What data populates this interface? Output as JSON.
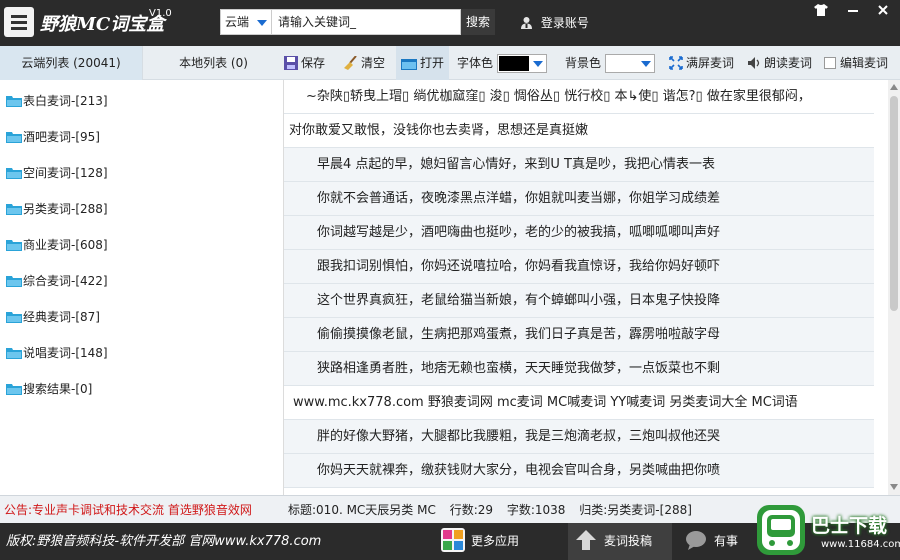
{
  "app": {
    "title": "野狼MC词宝盒",
    "version": "V1.0",
    "window_controls": [
      "shirt-icon",
      "minimize-icon",
      "close-icon"
    ]
  },
  "search": {
    "source": "云端",
    "placeholder": "请输入关键词",
    "value": "请输入关键词_",
    "button": "搜索"
  },
  "account": {
    "login": "登录账号"
  },
  "left_tabs": {
    "cloud": "云端列表 (20041)",
    "local": "本地列表 (0)"
  },
  "categories": [
    "表白麦词-[213]",
    "酒吧麦词-[95]",
    "空间麦词-[128]",
    "另类麦词-[288]",
    "商业麦词-[608]",
    "综合麦词-[422]",
    "经典麦词-[87]",
    "说唱麦词-[148]",
    "搜索结果-[0]"
  ],
  "toolbar": {
    "save": "保存",
    "clear": "清空",
    "open": "打开",
    "font_color_label": "字体色",
    "font_color": "#000000",
    "bg_color_label": "背景色",
    "bg_color": "#ffffff",
    "fullscreen": "满屏麦词",
    "read": "朗读麦词",
    "edit": "编辑麦词",
    "edit_checked": false
  },
  "content_lines": [
    "~杂陕▯轿曳上瑁▯ 绱优枷窳窪▯ 浚▯ 惆俗丛▯ 恍行校▯ 本↳使▯ 谐怎?▯      做在家里很郁闷，",
    "对你敢爱又敢恨，没钱你也去卖肾，思想还是真挺嫩",
    "早晨4 点起的早，媳妇留言心情好，来到U T真是吵，我把心情表一表",
    "你就不会普通话，夜晚漆黑点洋蜡，你姐就叫麦当娜，你姐学习成绩差",
    "你词越写越是少，酒吧嗨曲也挺吵，老的少的被我搞，呱唧呱唧叫声好",
    "跟我扣词别惧怕，你妈还说嘻拉哈，你妈看我直惊讶，我给你妈好顿吓",
    "这个世界真疯狂，老鼠给猫当新娘，有个蟑螂叫小强，日本鬼子快投降",
    "偷偷摸摸像老鼠，生病把那鸡蛋煮，我们日子真是苦，霹雳啪啦敲字母",
    "狭路相逢勇者胜，地痞无赖也蛮横，天天睡觉我做梦，一点饭菜也不剩",
    "www.mc.kx778.com 野狼麦词网 mc麦词 MC喊麦词 YY喊麦词 另类麦词大全 MC词语",
    "胖的好像大野猪，大腿都比我腰粗，我是三炮滴老叔，三炮叫叔他还哭",
    "你妈天天就裸奔，缴获钱财大家分，电视会官叫合身，另类喊曲把你喷"
  ],
  "status": {
    "announcement": "公告:专业声卡调试和技术交流 首选野狼音效网",
    "title": "标题:010. MC天辰另类 MC",
    "lines": "行数:29",
    "chars": "字数:1038",
    "category": "归类:另类麦词-[288]"
  },
  "footer": {
    "copyright": "版权:野狼音频科技-软件开发部 官网www.kx778.com",
    "more_apps": "更多应用",
    "upload": "麦词投稿",
    "help": "有事"
  },
  "watermark": {
    "title": "巴士下载",
    "url": "www.11684.com"
  }
}
